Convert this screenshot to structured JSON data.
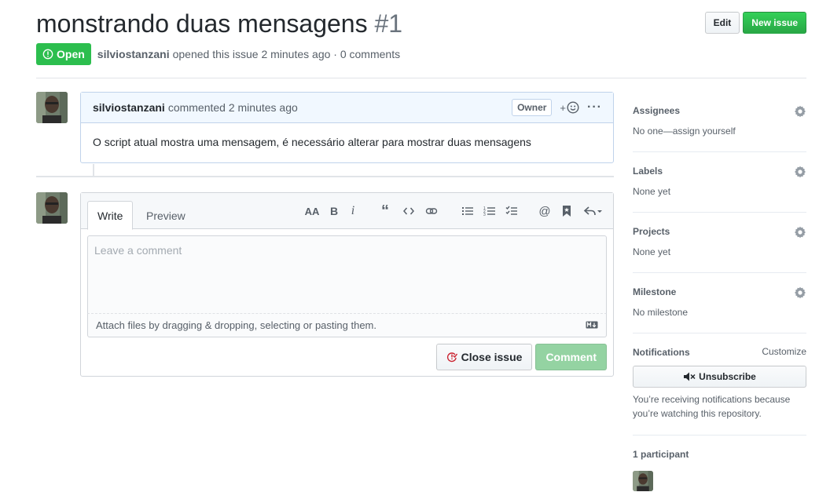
{
  "issue": {
    "title": "monstrando duas mensagens",
    "number": "#1",
    "state": "Open",
    "author": "silviostanzani",
    "opened_text": "opened this issue 2 minutes ago · 0 comments"
  },
  "header_actions": {
    "edit_label": "Edit",
    "new_issue_label": "New issue"
  },
  "comment": {
    "author": "silviostanzani",
    "meta": "commented 2 minutes ago",
    "owner_badge": "Owner",
    "body": "O script atual mostra uma mensagem, é necessário alterar para mostrar duas mensagens"
  },
  "composer": {
    "tabs": [
      "Write",
      "Preview"
    ],
    "placeholder": "Leave a comment",
    "attach_text": "Attach files by dragging & dropping, selecting or pasting them.",
    "close_issue_label": "Close issue",
    "comment_label": "Comment"
  },
  "sidebar": {
    "assignees": {
      "heading": "Assignees",
      "value": "No one—assign yourself"
    },
    "labels": {
      "heading": "Labels",
      "value": "None yet"
    },
    "projects": {
      "heading": "Projects",
      "value": "None yet"
    },
    "milestone": {
      "heading": "Milestone",
      "value": "No milestone"
    },
    "notifications": {
      "heading": "Notifications",
      "customize": "Customize",
      "unsubscribe": "Unsubscribe",
      "note": "You’re receiving notifications because you’re watching this repository."
    },
    "participants": {
      "heading": "1 participant"
    }
  },
  "colors": {
    "open_green": "#2cbe4e",
    "primary_green": "#28a745",
    "comment_header_bg": "#f1f8ff",
    "close_icon_red": "#cb2431"
  }
}
